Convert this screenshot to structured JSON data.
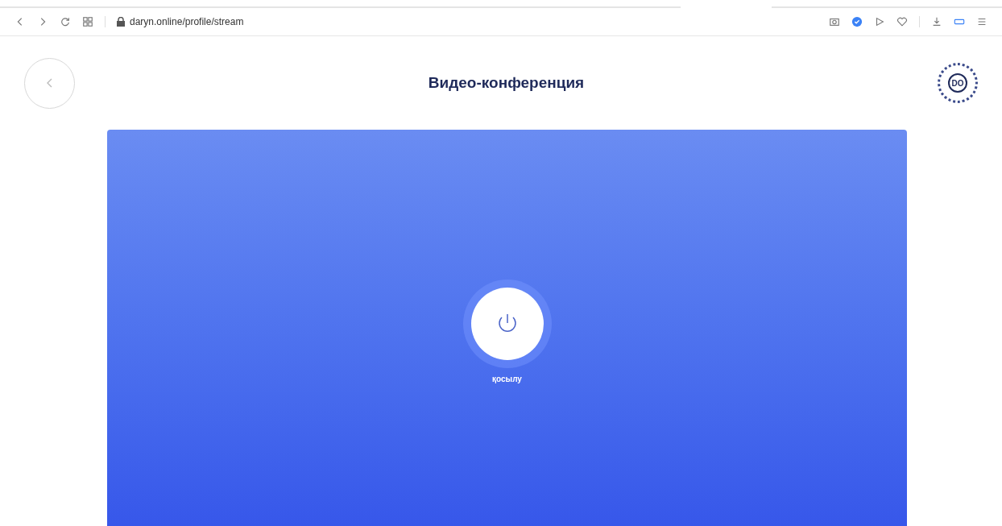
{
  "browser": {
    "url": "daryn.online/profile/stream"
  },
  "header": {
    "title": "Видео-конференция",
    "logo": "DO"
  },
  "stream": {
    "connect_label": "қосылу"
  }
}
